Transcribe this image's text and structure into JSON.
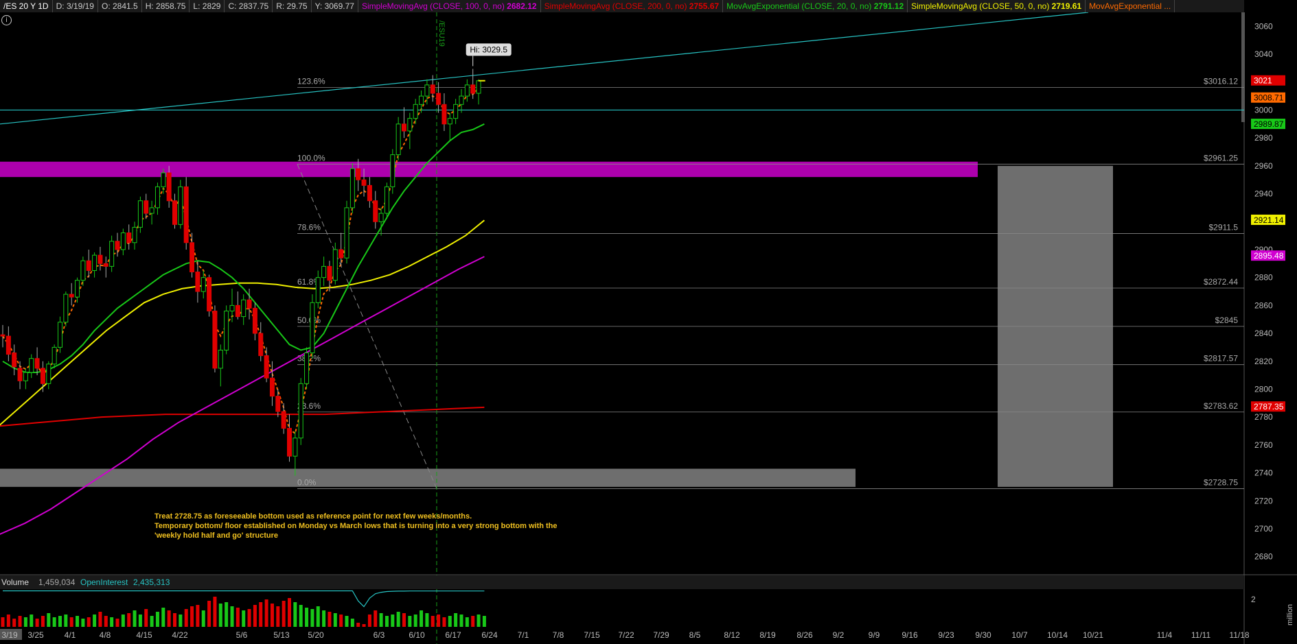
{
  "header": {
    "symbol": "/ES 20 Y 1D",
    "date": "D: 3/19/19",
    "open": "O: 2841.5",
    "high": "H: 2858.75",
    "low": "L: 2829",
    "close": "C: 2837.75",
    "range": "R: 29.75",
    "y": "Y: 3069.77",
    "studies": [
      {
        "label": "SimpleMovingAvg (CLOSE, 100, 0, no)",
        "value": "2682.12",
        "color": "#d100d1"
      },
      {
        "label": "SimpleMovingAvg (CLOSE, 200, 0, no)",
        "value": "2755.67",
        "color": "#e00000"
      },
      {
        "label": "MovAvgExponential (CLOSE, 20, 0, no)",
        "value": "2791.12",
        "color": "#18c818"
      },
      {
        "label": "SimpleMovingAvg (CLOSE, 50, 0, no)",
        "value": "2719.61",
        "color": "#f0f000"
      },
      {
        "label": "MovAvgExponential ...",
        "value": "",
        "color": "#ff6a00"
      }
    ]
  },
  "hi_label": "Hi: 3029.5",
  "event_label": "/ESU19",
  "annotation": {
    "lines": [
      "Treat 2728.75 as foreseeable bottom used as reference point for next few weeks/months.",
      "Temporary bottom/ floor established on Monday vs March lows that is turning into a very strong bottom with the",
      "'weekly hold half and go' structure"
    ],
    "color": "#f0c020"
  },
  "volume_panel": {
    "volume_label": "Volume",
    "volume_value": "1,459,034",
    "oi_label": "OpenInterest",
    "oi_value": "2,435,313",
    "axis_tick": "2",
    "axis_unit": "million"
  },
  "chart_data": {
    "type": "candlestick",
    "y_axis_ticks": [
      2680,
      2700,
      2720,
      2740,
      2760,
      2780,
      2800,
      2820,
      2840,
      2860,
      2880,
      2900,
      2920,
      2940,
      2960,
      2980,
      3000,
      3020,
      3040,
      3060
    ],
    "ylim": [
      2670,
      3070
    ],
    "x_labels": [
      "3/19",
      "3/25",
      "4/1",
      "4/8",
      "4/15",
      "4/22",
      "5/6",
      "5/13",
      "5/20",
      "6/3",
      "6/10",
      "6/17",
      "6/24",
      "7/1",
      "7/8",
      "7/15",
      "7/22",
      "7/29",
      "8/5",
      "8/12",
      "8/19",
      "8/26",
      "9/2",
      "9/9",
      "9/16",
      "9/23",
      "9/30",
      "10/7",
      "10/14",
      "10/21",
      "11/4",
      "11/11",
      "11/18"
    ],
    "fib_levels": [
      {
        "pct": "123.6%",
        "price": 3016.12,
        "label": "$3016.12"
      },
      {
        "pct": "100.0%",
        "price": 2961.25,
        "label": "$2961.25"
      },
      {
        "pct": "78.6%",
        "price": 2911.5,
        "label": "$2911.5"
      },
      {
        "pct": "61.8%",
        "price": 2872.44,
        "label": "$2872.44"
      },
      {
        "pct": "50.0%",
        "price": 2845,
        "label": "$2845"
      },
      {
        "pct": "38.2%",
        "price": 2817.57,
        "label": "$2817.57"
      },
      {
        "pct": "23.6%",
        "price": 2783.62,
        "label": "$2783.62"
      },
      {
        "pct": "0.0%",
        "price": 2728.75,
        "label": "$2728.75"
      }
    ],
    "price_tags": [
      {
        "value": "3021",
        "price": 3021,
        "bg": "#e00000",
        "fg": "#fff"
      },
      {
        "value": "3008.71",
        "price": 3008.71,
        "bg": "#ff6a00",
        "fg": "#000"
      },
      {
        "value": "2989.87",
        "price": 2989.87,
        "bg": "#18c818",
        "fg": "#000"
      },
      {
        "value": "2921.14",
        "price": 2921.14,
        "bg": "#f0f000",
        "fg": "#000"
      },
      {
        "value": "2895.48",
        "price": 2895.48,
        "bg": "#d100d1",
        "fg": "#fff"
      },
      {
        "value": "2787.35",
        "price": 2787.35,
        "bg": "#e00000",
        "fg": "#fff"
      }
    ],
    "horizontal_line_price": 3000,
    "zones": [
      {
        "name": "resistance-zone",
        "from": 2952,
        "to": 2963,
        "color": "#c000c0"
      },
      {
        "name": "support-zone",
        "from": 2730,
        "to": 2743,
        "color": "#7a7a7a"
      }
    ],
    "projection_box": {
      "from": 2730,
      "to": 2960,
      "color": "#6e6e6e"
    },
    "candles": [
      [
        2839,
        2846,
        2830,
        2838
      ],
      [
        2838,
        2845,
        2820,
        2825
      ],
      [
        2826,
        2832,
        2810,
        2816
      ],
      [
        2815,
        2820,
        2800,
        2806
      ],
      [
        2806,
        2815,
        2800,
        2812
      ],
      [
        2812,
        2825,
        2808,
        2822
      ],
      [
        2822,
        2830,
        2810,
        2815
      ],
      [
        2815,
        2820,
        2798,
        2804
      ],
      [
        2804,
        2820,
        2800,
        2818
      ],
      [
        2818,
        2832,
        2815,
        2830
      ],
      [
        2830,
        2852,
        2826,
        2848
      ],
      [
        2848,
        2870,
        2845,
        2868
      ],
      [
        2868,
        2876,
        2860,
        2866
      ],
      [
        2866,
        2880,
        2862,
        2878
      ],
      [
        2878,
        2895,
        2874,
        2892
      ],
      [
        2892,
        2900,
        2880,
        2885
      ],
      [
        2885,
        2898,
        2880,
        2896
      ],
      [
        2896,
        2902,
        2885,
        2890
      ],
      [
        2890,
        2895,
        2880,
        2888
      ],
      [
        2888,
        2910,
        2884,
        2906
      ],
      [
        2906,
        2912,
        2895,
        2900
      ],
      [
        2900,
        2915,
        2896,
        2912
      ],
      [
        2912,
        2918,
        2900,
        2905
      ],
      [
        2905,
        2920,
        2900,
        2916
      ],
      [
        2916,
        2938,
        2912,
        2935
      ],
      [
        2935,
        2940,
        2922,
        2926
      ],
      [
        2926,
        2935,
        2918,
        2930
      ],
      [
        2930,
        2948,
        2925,
        2945
      ],
      [
        2945,
        2958,
        2940,
        2955
      ],
      [
        2955,
        2960,
        2930,
        2935
      ],
      [
        2935,
        2940,
        2915,
        2918
      ],
      [
        2918,
        2950,
        2915,
        2945
      ],
      [
        2945,
        2952,
        2900,
        2905
      ],
      [
        2905,
        2912,
        2880,
        2884
      ],
      [
        2884,
        2892,
        2862,
        2870
      ],
      [
        2870,
        2885,
        2865,
        2880
      ],
      [
        2880,
        2882,
        2852,
        2856
      ],
      [
        2856,
        2860,
        2812,
        2815
      ],
      [
        2815,
        2832,
        2802,
        2828
      ],
      [
        2828,
        2860,
        2825,
        2856
      ],
      [
        2856,
        2872,
        2848,
        2860
      ],
      [
        2860,
        2870,
        2850,
        2852
      ],
      [
        2852,
        2868,
        2846,
        2864
      ],
      [
        2864,
        2872,
        2850,
        2858
      ],
      [
        2858,
        2862,
        2835,
        2840
      ],
      [
        2840,
        2848,
        2820,
        2824
      ],
      [
        2824,
        2830,
        2805,
        2808
      ],
      [
        2808,
        2820,
        2788,
        2795
      ],
      [
        2795,
        2800,
        2780,
        2784
      ],
      [
        2784,
        2790,
        2768,
        2772
      ],
      [
        2772,
        2782,
        2748,
        2752
      ],
      [
        2752,
        2770,
        2738,
        2765
      ],
      [
        2765,
        2808,
        2760,
        2804
      ],
      [
        2804,
        2830,
        2800,
        2826
      ],
      [
        2826,
        2868,
        2822,
        2862
      ],
      [
        2862,
        2885,
        2858,
        2880
      ],
      [
        2880,
        2895,
        2874,
        2888
      ],
      [
        2888,
        2892,
        2870,
        2878
      ],
      [
        2878,
        2905,
        2875,
        2900
      ],
      [
        2900,
        2912,
        2888,
        2894
      ],
      [
        2894,
        2935,
        2890,
        2930
      ],
      [
        2930,
        2962,
        2926,
        2958
      ],
      [
        2958,
        2965,
        2942,
        2950
      ],
      [
        2950,
        2958,
        2938,
        2946
      ],
      [
        2946,
        2952,
        2930,
        2935
      ],
      [
        2935,
        2942,
        2915,
        2920
      ],
      [
        2920,
        2930,
        2910,
        2926
      ],
      [
        2926,
        2948,
        2922,
        2945
      ],
      [
        2945,
        2972,
        2940,
        2968
      ],
      [
        2968,
        2995,
        2964,
        2990
      ],
      [
        2990,
        3002,
        2980,
        2985
      ],
      [
        2985,
        2998,
        2972,
        2994
      ],
      [
        2994,
        3008,
        2990,
        3004
      ],
      [
        3004,
        3014,
        2998,
        3010
      ],
      [
        3010,
        3022,
        3004,
        3018
      ],
      [
        3018,
        3025,
        3006,
        3012
      ],
      [
        3012,
        3020,
        2998,
        3004
      ],
      [
        3004,
        3012,
        2985,
        2990
      ],
      [
        2990,
        2998,
        2978,
        2994
      ],
      [
        2994,
        3008,
        2990,
        3004
      ],
      [
        3004,
        3015,
        2998,
        3010
      ],
      [
        3010,
        3022,
        3006,
        3018
      ],
      [
        3018,
        3029.5,
        3008,
        3012
      ],
      [
        3012,
        3022,
        3004,
        3021
      ]
    ],
    "ema20": [
      2820,
      2815,
      2812,
      2812,
      2814,
      2818,
      2824,
      2832,
      2842,
      2850,
      2858,
      2864,
      2870,
      2876,
      2882,
      2886,
      2890,
      2892,
      2891,
      2886,
      2880,
      2872,
      2862,
      2852,
      2842,
      2832,
      2828,
      2830,
      2840,
      2856,
      2872,
      2888,
      2902,
      2916,
      2930,
      2942,
      2952,
      2962,
      2970,
      2978,
      2984,
      2986,
      2990
    ],
    "sma50": [
      2760,
      2770,
      2782,
      2794,
      2806,
      2818,
      2830,
      2842,
      2852,
      2862,
      2868,
      2872,
      2874,
      2875,
      2876,
      2876,
      2875,
      2873,
      2872,
      2873,
      2875,
      2878,
      2882,
      2888,
      2895,
      2902,
      2910,
      2921
    ],
    "sma100": [
      2690,
      2696,
      2704,
      2714,
      2726,
      2738,
      2750,
      2764,
      2776,
      2786,
      2796,
      2806,
      2816,
      2826,
      2836,
      2846,
      2856,
      2866,
      2876,
      2886,
      2895
    ],
    "sma200": [
      2772,
      2774,
      2776,
      2778,
      2780,
      2781,
      2782,
      2782,
      2782,
      2782,
      2782,
      2782,
      2783,
      2784,
      2785,
      2786,
      2787
    ],
    "volume": [
      0.7,
      0.9,
      0.6,
      0.8,
      0.7,
      0.9,
      0.6,
      0.8,
      1.0,
      0.7,
      0.8,
      0.9,
      0.7,
      0.8,
      0.6,
      0.7,
      0.9,
      1.1,
      0.8,
      0.7,
      0.6,
      0.9,
      1.0,
      1.2,
      0.9,
      1.3,
      0.8,
      1.1,
      1.4,
      1.2,
      1.0,
      0.9,
      1.3,
      1.5,
      1.6,
      1.2,
      1.9,
      2.2,
      1.7,
      1.8,
      1.5,
      1.4,
      1.2,
      1.3,
      1.6,
      1.8,
      2.0,
      1.7,
      1.5,
      1.9,
      2.1,
      1.8,
      1.6,
      1.4,
      1.3,
      1.5,
      1.2,
      1.1,
      1.0,
      0.9,
      0.8,
      0.6,
      0.3,
      0.2,
      0.9,
      1.2,
      1.0,
      0.8,
      0.9,
      1.1,
      1.0,
      0.8,
      0.9,
      1.2,
      1.0,
      0.8,
      0.9,
      0.7,
      0.8,
      1.0,
      0.9,
      0.7,
      0.8,
      0.9,
      0.8
    ],
    "oi": [
      2.5,
      2.5,
      2.5,
      2.5,
      2.5,
      2.5,
      2.5,
      2.5,
      2.5,
      2.5,
      2.5,
      2.5,
      2.5,
      2.5,
      2.5,
      2.5,
      2.5,
      2.5,
      2.5,
      2.5,
      2.5,
      2.5,
      2.5,
      2.5,
      2.5,
      2.5,
      2.5,
      2.5,
      2.5,
      2.5,
      2.5,
      2.5,
      2.5,
      2.5,
      2.5,
      2.5,
      2.5,
      2.5,
      2.5,
      2.5,
      2.5,
      2.5,
      2.5,
      2.5,
      2.5,
      2.5,
      2.5,
      2.5,
      2.5,
      2.5,
      2.5,
      2.5,
      2.5,
      2.5,
      2.5,
      2.5,
      2.5,
      2.5,
      2.5,
      2.5,
      2.5,
      2.5,
      1.8,
      1.4,
      2.0,
      2.3,
      2.4,
      2.45,
      2.47,
      2.48,
      2.48,
      2.49,
      2.49,
      2.49,
      2.49,
      2.49,
      2.49,
      2.49,
      2.49,
      2.49,
      2.49,
      2.49,
      2.49,
      2.49,
      2.49
    ]
  }
}
